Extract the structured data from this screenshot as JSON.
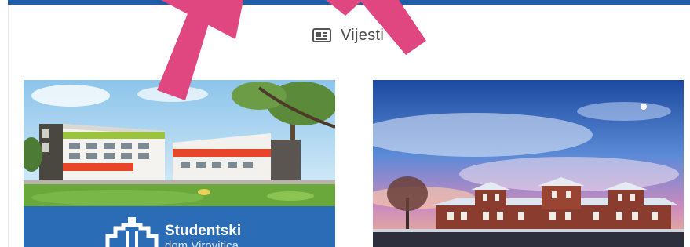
{
  "section": {
    "title": "Vijesti",
    "icon": "newspaper-icon"
  },
  "cards": [
    {
      "brand_title": "Studentski",
      "brand_subtitle": "dom Virovitica"
    },
    {}
  ],
  "colors": {
    "top_bar": "#1f5fa8",
    "brand_banner": "#2a6cb6",
    "arrow": "#e0467f"
  }
}
